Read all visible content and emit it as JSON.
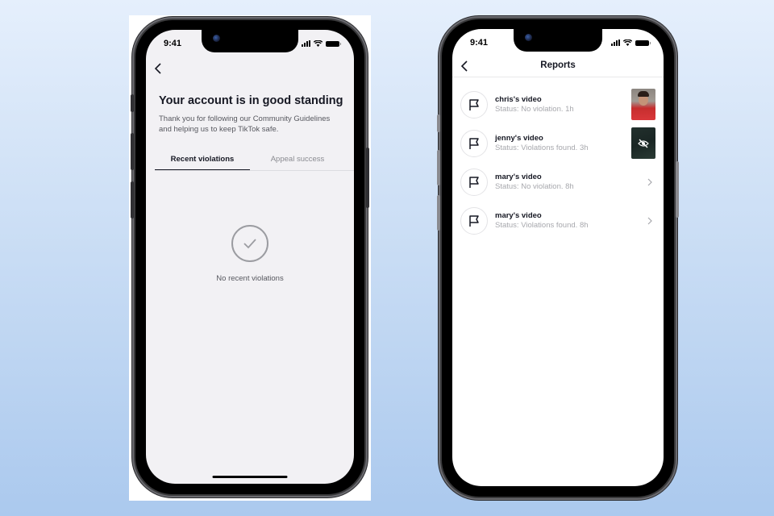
{
  "left_phone": {
    "status_bar": {
      "time": "9:41"
    },
    "header": {
      "back_icon": "chevron-left-icon"
    },
    "title": "Your account is in good standing",
    "description": "Thank you for following our Community Guidelines and helping us to keep TikTok safe.",
    "tabs": [
      {
        "label": "Recent violations",
        "active": true
      },
      {
        "label": "Appeal success",
        "active": false
      }
    ],
    "empty_state": {
      "icon": "check-circle-icon",
      "text": "No recent violations"
    }
  },
  "right_phone": {
    "status_bar": {
      "time": "9:41"
    },
    "header": {
      "title": "Reports",
      "back_icon": "chevron-left-icon"
    },
    "reports": [
      {
        "name": "chris's video",
        "status": "Status: No violation.",
        "time": "1h",
        "trailing": "thumbnail"
      },
      {
        "name": "jenny's video",
        "status": "Status: Violations found.",
        "time": "3h",
        "trailing": "hidden-thumbnail"
      },
      {
        "name": "mary's video",
        "status": "Status: No violation.",
        "time": "8h",
        "trailing": "chevron"
      },
      {
        "name": "mary's video",
        "status": "Status: Violations found.",
        "time": "8h",
        "trailing": "chevron"
      }
    ]
  },
  "colors": {
    "text_primary": "#161823",
    "text_secondary": "#57585f",
    "text_muted": "#a7a8ad",
    "screen_bg_left": "#f2f1f4",
    "screen_bg_right": "#ffffff"
  }
}
